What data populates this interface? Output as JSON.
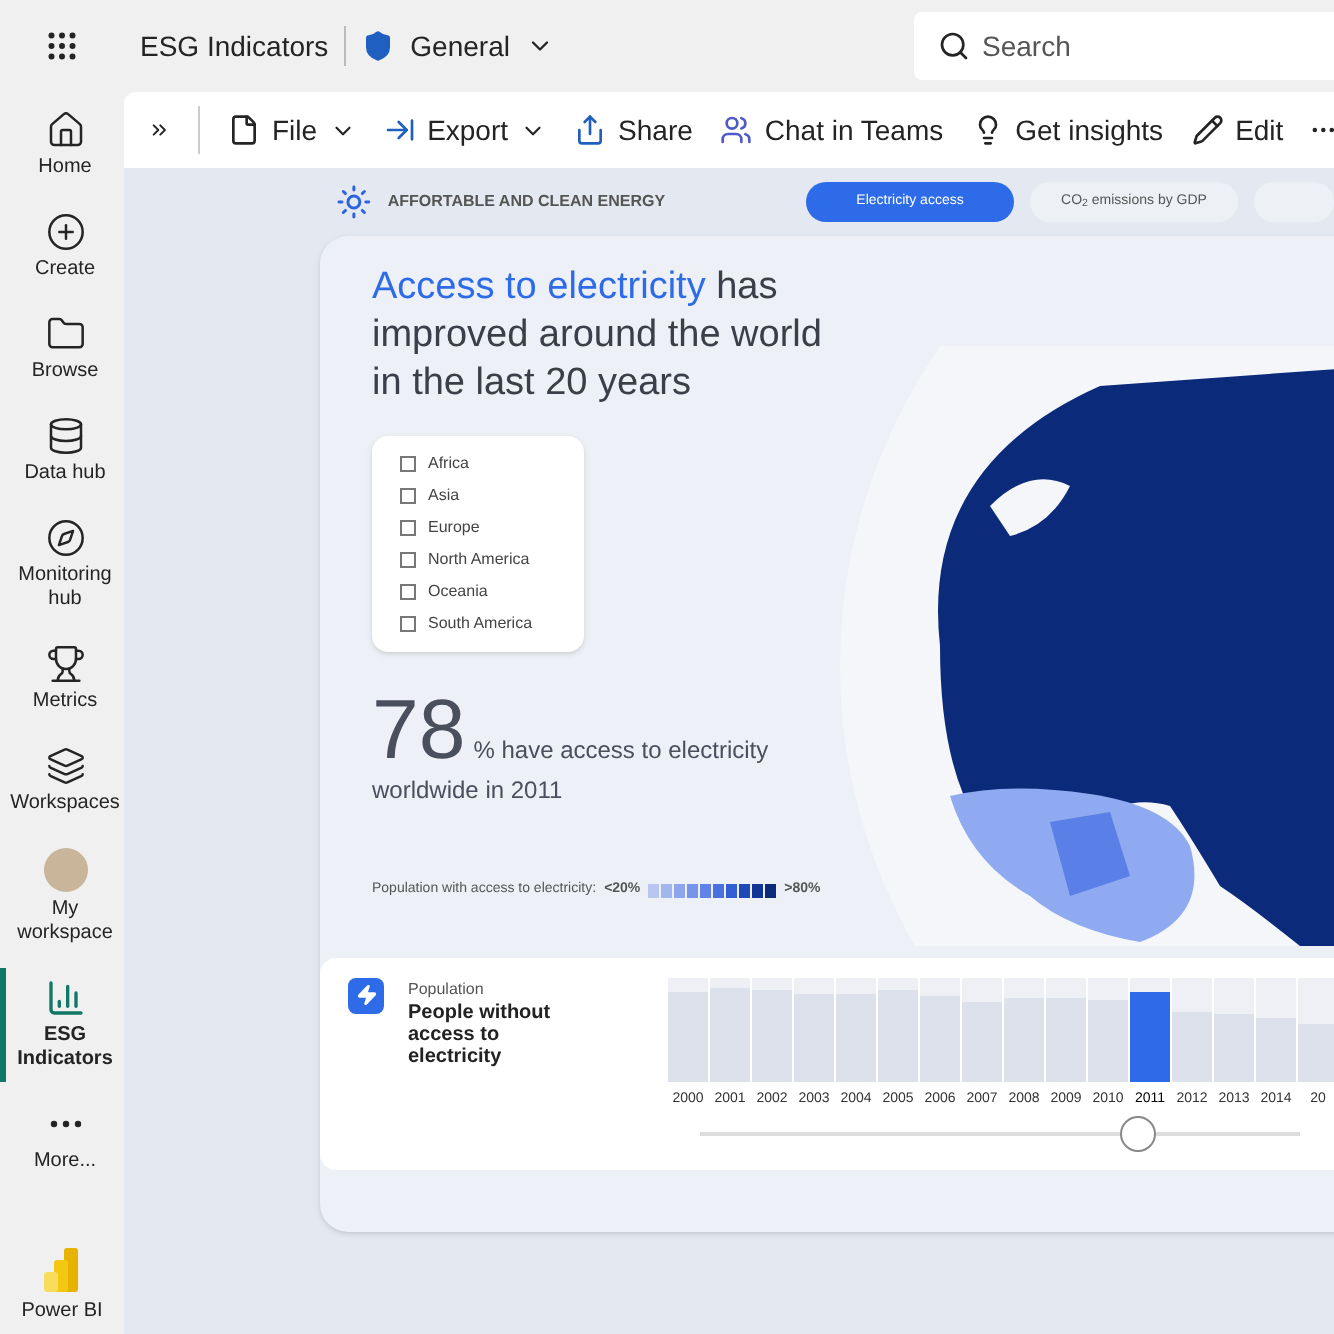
{
  "header": {
    "report_name": "ESG Indicators",
    "workspace": "General",
    "search": {
      "placeholder": "Search"
    }
  },
  "sidebar": {
    "items": [
      {
        "label": "Home",
        "selected": false
      },
      {
        "label": "Create",
        "selected": false
      },
      {
        "label": "Browse",
        "selected": false
      },
      {
        "label": "Data hub",
        "selected": false
      },
      {
        "label": "Monitoring hub",
        "selected": false
      },
      {
        "label": "Metrics",
        "selected": false
      },
      {
        "label": "Workspaces",
        "selected": false
      },
      {
        "label": "My workspace",
        "selected": false
      },
      {
        "label": "ESG Indicators",
        "selected": true
      },
      {
        "label": "More...",
        "selected": false
      }
    ],
    "footer": "Power BI"
  },
  "toolbar": [
    {
      "label": "File",
      "dropdown": true
    },
    {
      "label": "Export",
      "dropdown": true
    },
    {
      "label": "Share",
      "dropdown": false
    },
    {
      "label": "Chat in Teams",
      "dropdown": false
    },
    {
      "label": "Get insights",
      "dropdown": false
    },
    {
      "label": "Edit",
      "dropdown": false
    }
  ],
  "report": {
    "section_title": "AFFORTABLE AND CLEAN ENERGY",
    "tabs": [
      {
        "label": "Electricity access",
        "selected": true
      },
      {
        "label": "CO$_{2}$ emissions by GDP",
        "selected": false
      },
      {
        "selected": false
      }
    ],
    "headline": {
      "highlight": "Access to electricity",
      "rest": "has improved around the world in the last 20 years"
    },
    "regions": [
      {
        "label": "Africa",
        "checked": false
      },
      {
        "label": "Asia",
        "checked": false
      },
      {
        "label": "Europe",
        "checked": false
      },
      {
        "label": "North America",
        "checked": false
      },
      {
        "label": "Oceania",
        "checked": false
      },
      {
        "label": "South America",
        "checked": false
      }
    ],
    "stat": {
      "value": "78",
      "text": "% have access to electricity",
      "subtext": "worldwide in 2011"
    },
    "legend": {
      "label": "Population with access to electricity:",
      "low": "<20%",
      "high": ">80%"
    },
    "population_card": {
      "kicker": "Population",
      "title": "People without access to electricity",
      "years": [
        {
          "label": "2000",
          "selected": false
        },
        {
          "label": "2001",
          "selected": false
        },
        {
          "label": "2002",
          "selected": false
        },
        {
          "label": "2003",
          "selected": false
        },
        {
          "label": "2004",
          "selected": false
        },
        {
          "label": "2005",
          "selected": false
        },
        {
          "label": "2006",
          "selected": false
        },
        {
          "label": "2007",
          "selected": false
        },
        {
          "label": "2008",
          "selected": false
        },
        {
          "label": "2009",
          "selected": false
        },
        {
          "label": "2010",
          "selected": false
        },
        {
          "label": "2011",
          "selected": true
        },
        {
          "label": "2012",
          "selected": false
        },
        {
          "label": "2013",
          "selected": false
        },
        {
          "label": "2014",
          "selected": false
        },
        {
          "label": "20",
          "selected": false
        }
      ],
      "slider": {
        "level": 0.73
      }
    }
  }
}
